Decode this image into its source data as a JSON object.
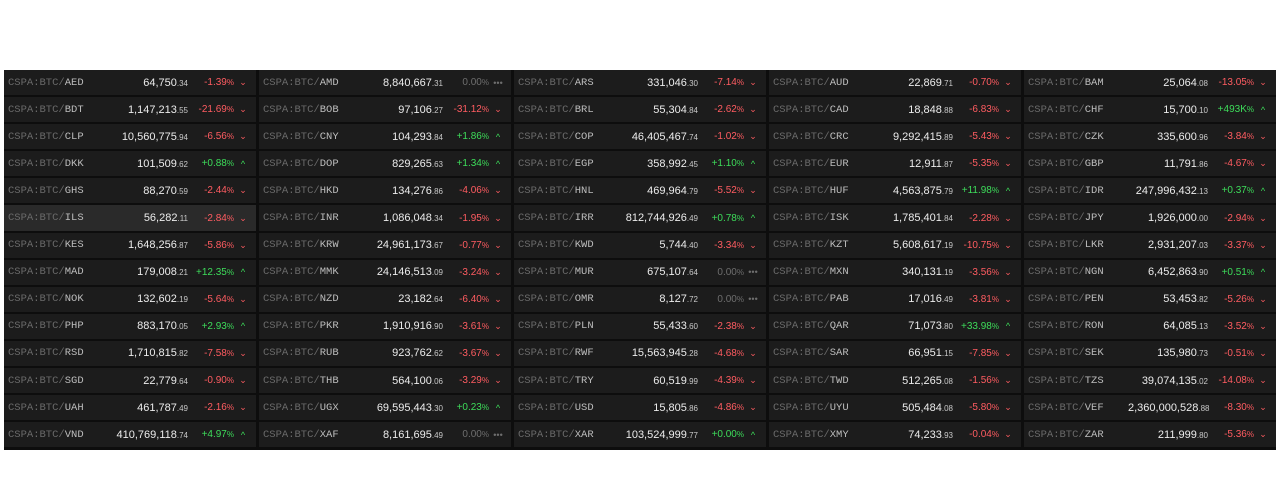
{
  "board": {
    "prefix": "CSPA:BTC/",
    "columns": [
      [
        {
          "ccy": "AED",
          "int": "64,750",
          "dec": ".34",
          "chg_int": "-1.39",
          "chg_tail": "%",
          "dir": "down",
          "arrow": "⌄"
        },
        {
          "ccy": "BDT",
          "int": "1,147,213",
          "dec": ".55",
          "chg_int": "-21.69",
          "chg_tail": "%",
          "dir": "down",
          "arrow": "⌄"
        },
        {
          "ccy": "CLP",
          "int": "10,560,775",
          "dec": ".94",
          "chg_int": "-6.56",
          "chg_tail": "%",
          "dir": "down",
          "arrow": "⌄"
        },
        {
          "ccy": "DKK",
          "int": "101,509",
          "dec": ".62",
          "chg_int": "+0.88",
          "chg_tail": "%",
          "dir": "up",
          "arrow": "^"
        },
        {
          "ccy": "GHS",
          "int": "88,270",
          "dec": ".59",
          "chg_int": "-2.44",
          "chg_tail": "%",
          "dir": "down",
          "arrow": "⌄"
        },
        {
          "ccy": "ILS",
          "int": "56,282",
          "dec": ".11",
          "chg_int": "-2.84",
          "chg_tail": "%",
          "dir": "down",
          "arrow": "⌄",
          "hl": true
        },
        {
          "ccy": "KES",
          "int": "1,648,256",
          "dec": ".87",
          "chg_int": "-5.86",
          "chg_tail": "%",
          "dir": "down",
          "arrow": "⌄"
        },
        {
          "ccy": "MAD",
          "int": "179,008",
          "dec": ".21",
          "chg_int": "+12.35",
          "chg_tail": "%",
          "dir": "up",
          "arrow": "^"
        },
        {
          "ccy": "NOK",
          "int": "132,602",
          "dec": ".19",
          "chg_int": "-5.64",
          "chg_tail": "%",
          "dir": "down",
          "arrow": "⌄"
        },
        {
          "ccy": "PHP",
          "int": "883,170",
          "dec": ".05",
          "chg_int": "+2.93",
          "chg_tail": "%",
          "dir": "up",
          "arrow": "^"
        },
        {
          "ccy": "RSD",
          "int": "1,710,815",
          "dec": ".82",
          "chg_int": "-7.58",
          "chg_tail": "%",
          "dir": "down",
          "arrow": "⌄"
        },
        {
          "ccy": "SGD",
          "int": "22,779",
          "dec": ".64",
          "chg_int": "-0.90",
          "chg_tail": "%",
          "dir": "down",
          "arrow": "⌄"
        },
        {
          "ccy": "UAH",
          "int": "461,787",
          "dec": ".49",
          "chg_int": "-2.16",
          "chg_tail": "%",
          "dir": "down",
          "arrow": "⌄"
        },
        {
          "ccy": "VND",
          "int": "410,769,118",
          "dec": ".74",
          "chg_int": "+4.97",
          "chg_tail": "%",
          "dir": "up",
          "arrow": "^"
        }
      ],
      [
        {
          "ccy": "AMD",
          "int": "8,840,667",
          "dec": ".31",
          "chg_int": "0.00",
          "chg_tail": "%",
          "dir": "flat",
          "arrow": "•••"
        },
        {
          "ccy": "BOB",
          "int": "97,106",
          "dec": ".27",
          "chg_int": "-31.12",
          "chg_tail": "%",
          "dir": "down",
          "arrow": "⌄"
        },
        {
          "ccy": "CNY",
          "int": "104,293",
          "dec": ".84",
          "chg_int": "+1.86",
          "chg_tail": "%",
          "dir": "up",
          "arrow": "^"
        },
        {
          "ccy": "DOP",
          "int": "829,265",
          "dec": ".63",
          "chg_int": "+1.34",
          "chg_tail": "%",
          "dir": "up",
          "arrow": "^"
        },
        {
          "ccy": "HKD",
          "int": "134,276",
          "dec": ".86",
          "chg_int": "-4.06",
          "chg_tail": "%",
          "dir": "down",
          "arrow": "⌄"
        },
        {
          "ccy": "INR",
          "int": "1,086,048",
          "dec": ".34",
          "chg_int": "-1.95",
          "chg_tail": "%",
          "dir": "down",
          "arrow": "⌄"
        },
        {
          "ccy": "KRW",
          "int": "24,961,173",
          "dec": ".67",
          "chg_int": "-0.77",
          "chg_tail": "%",
          "dir": "down",
          "arrow": "⌄"
        },
        {
          "ccy": "MMK",
          "int": "24,146,513",
          "dec": ".09",
          "chg_int": "-3.24",
          "chg_tail": "%",
          "dir": "down",
          "arrow": "⌄"
        },
        {
          "ccy": "NZD",
          "int": "23,182",
          "dec": ".64",
          "chg_int": "-6.40",
          "chg_tail": "%",
          "dir": "down",
          "arrow": "⌄"
        },
        {
          "ccy": "PKR",
          "int": "1,910,916",
          "dec": ".90",
          "chg_int": "-3.61",
          "chg_tail": "%",
          "dir": "down",
          "arrow": "⌄"
        },
        {
          "ccy": "RUB",
          "int": "923,762",
          "dec": ".62",
          "chg_int": "-3.67",
          "chg_tail": "%",
          "dir": "down",
          "arrow": "⌄"
        },
        {
          "ccy": "THB",
          "int": "564,100",
          "dec": ".06",
          "chg_int": "-3.29",
          "chg_tail": "%",
          "dir": "down",
          "arrow": "⌄"
        },
        {
          "ccy": "UGX",
          "int": "69,595,443",
          "dec": ".30",
          "chg_int": "+0.23",
          "chg_tail": "%",
          "dir": "up",
          "arrow": "^"
        },
        {
          "ccy": "XAF",
          "int": "8,161,695",
          "dec": ".49",
          "chg_int": "0.00",
          "chg_tail": "%",
          "dir": "flat",
          "arrow": "•••"
        }
      ],
      [
        {
          "ccy": "ARS",
          "int": "331,046",
          "dec": ".30",
          "chg_int": "-7.14",
          "chg_tail": "%",
          "dir": "down",
          "arrow": "⌄"
        },
        {
          "ccy": "BRL",
          "int": "55,304",
          "dec": ".84",
          "chg_int": "-2.62",
          "chg_tail": "%",
          "dir": "down",
          "arrow": "⌄"
        },
        {
          "ccy": "COP",
          "int": "46,405,467",
          "dec": ".74",
          "chg_int": "-1.02",
          "chg_tail": "%",
          "dir": "down",
          "arrow": "⌄"
        },
        {
          "ccy": "EGP",
          "int": "358,992",
          "dec": ".45",
          "chg_int": "+1.10",
          "chg_tail": "%",
          "dir": "up",
          "arrow": "^"
        },
        {
          "ccy": "HNL",
          "int": "469,964",
          "dec": ".79",
          "chg_int": "-5.52",
          "chg_tail": "%",
          "dir": "down",
          "arrow": "⌄"
        },
        {
          "ccy": "IRR",
          "int": "812,744,926",
          "dec": ".49",
          "chg_int": "+0.78",
          "chg_tail": "%",
          "dir": "up",
          "arrow": "^"
        },
        {
          "ccy": "KWD",
          "int": "5,744",
          "dec": ".40",
          "chg_int": "-3.34",
          "chg_tail": "%",
          "dir": "down",
          "arrow": "⌄"
        },
        {
          "ccy": "MUR",
          "int": "675,107",
          "dec": ".64",
          "chg_int": "0.00",
          "chg_tail": "%",
          "dir": "flat",
          "arrow": "•••"
        },
        {
          "ccy": "OMR",
          "int": "8,127",
          "dec": ".72",
          "chg_int": "0.00",
          "chg_tail": "%",
          "dir": "flat",
          "arrow": "•••"
        },
        {
          "ccy": "PLN",
          "int": "55,433",
          "dec": ".60",
          "chg_int": "-2.38",
          "chg_tail": "%",
          "dir": "down",
          "arrow": "⌄"
        },
        {
          "ccy": "RWF",
          "int": "15,563,945",
          "dec": ".28",
          "chg_int": "-4.68",
          "chg_tail": "%",
          "dir": "down",
          "arrow": "⌄"
        },
        {
          "ccy": "TRY",
          "int": "60,519",
          "dec": ".99",
          "chg_int": "-4.39",
          "chg_tail": "%",
          "dir": "down",
          "arrow": "⌄"
        },
        {
          "ccy": "USD",
          "int": "15,805",
          "dec": ".86",
          "chg_int": "-4.86",
          "chg_tail": "%",
          "dir": "down",
          "arrow": "⌄"
        },
        {
          "ccy": "XAR",
          "int": "103,524,999",
          "dec": ".77",
          "chg_int": "+0.00",
          "chg_tail": "%",
          "dir": "up",
          "arrow": "^"
        }
      ],
      [
        {
          "ccy": "AUD",
          "int": "22,869",
          "dec": ".71",
          "chg_int": "-0.70",
          "chg_tail": "%",
          "dir": "down",
          "arrow": "⌄"
        },
        {
          "ccy": "CAD",
          "int": "18,848",
          "dec": ".88",
          "chg_int": "-6.83",
          "chg_tail": "%",
          "dir": "down",
          "arrow": "⌄"
        },
        {
          "ccy": "CRC",
          "int": "9,292,415",
          "dec": ".89",
          "chg_int": "-5.43",
          "chg_tail": "%",
          "dir": "down",
          "arrow": "⌄"
        },
        {
          "ccy": "EUR",
          "int": "12,911",
          "dec": ".87",
          "chg_int": "-5.35",
          "chg_tail": "%",
          "dir": "down",
          "arrow": "⌄"
        },
        {
          "ccy": "HUF",
          "int": "4,563,875",
          "dec": ".79",
          "chg_int": "+11.98",
          "chg_tail": "%",
          "dir": "up",
          "arrow": "^"
        },
        {
          "ccy": "ISK",
          "int": "1,785,401",
          "dec": ".84",
          "chg_int": "-2.28",
          "chg_tail": "%",
          "dir": "down",
          "arrow": "⌄"
        },
        {
          "ccy": "KZT",
          "int": "5,608,617",
          "dec": ".19",
          "chg_int": "-10.75",
          "chg_tail": "%",
          "dir": "down",
          "arrow": "⌄"
        },
        {
          "ccy": "MXN",
          "int": "340,131",
          "dec": ".19",
          "chg_int": "-3.56",
          "chg_tail": "%",
          "dir": "down",
          "arrow": "⌄"
        },
        {
          "ccy": "PAB",
          "int": "17,016",
          "dec": ".49",
          "chg_int": "-3.81",
          "chg_tail": "%",
          "dir": "down",
          "arrow": "⌄"
        },
        {
          "ccy": "QAR",
          "int": "71,073",
          "dec": ".80",
          "chg_int": "+33.98",
          "chg_tail": "%",
          "dir": "up",
          "arrow": "^"
        },
        {
          "ccy": "SAR",
          "int": "66,951",
          "dec": ".15",
          "chg_int": "-7.85",
          "chg_tail": "%",
          "dir": "down",
          "arrow": "⌄"
        },
        {
          "ccy": "TWD",
          "int": "512,265",
          "dec": ".08",
          "chg_int": "-1.56",
          "chg_tail": "%",
          "dir": "down",
          "arrow": "⌄"
        },
        {
          "ccy": "UYU",
          "int": "505,484",
          "dec": ".08",
          "chg_int": "-5.80",
          "chg_tail": "%",
          "dir": "down",
          "arrow": "⌄"
        },
        {
          "ccy": "XMY",
          "int": "74,233",
          "dec": ".93",
          "chg_int": "-0.04",
          "chg_tail": "%",
          "dir": "down",
          "arrow": "⌄"
        }
      ],
      [
        {
          "ccy": "BAM",
          "int": "25,064",
          "dec": ".08",
          "chg_int": "-13.05",
          "chg_tail": "%",
          "dir": "down",
          "arrow": "⌄"
        },
        {
          "ccy": "CHF",
          "int": "15,700",
          "dec": ".10",
          "chg_int": "+493K",
          "chg_tail": "%",
          "dir": "up",
          "arrow": "^"
        },
        {
          "ccy": "CZK",
          "int": "335,600",
          "dec": ".96",
          "chg_int": "-3.84",
          "chg_tail": "%",
          "dir": "down",
          "arrow": "⌄"
        },
        {
          "ccy": "GBP",
          "int": "11,791",
          "dec": ".86",
          "chg_int": "-4.67",
          "chg_tail": "%",
          "dir": "down",
          "arrow": "⌄"
        },
        {
          "ccy": "IDR",
          "int": "247,996,432",
          "dec": ".13",
          "chg_int": "+0.37",
          "chg_tail": "%",
          "dir": "up",
          "arrow": "^"
        },
        {
          "ccy": "JPY",
          "int": "1,926,000",
          "dec": ".00",
          "chg_int": "-2.94",
          "chg_tail": "%",
          "dir": "down",
          "arrow": "⌄"
        },
        {
          "ccy": "LKR",
          "int": "2,931,207",
          "dec": ".03",
          "chg_int": "-3.37",
          "chg_tail": "%",
          "dir": "down",
          "arrow": "⌄"
        },
        {
          "ccy": "NGN",
          "int": "6,452,863",
          "dec": ".90",
          "chg_int": "+0.51",
          "chg_tail": "%",
          "dir": "up",
          "arrow": "^"
        },
        {
          "ccy": "PEN",
          "int": "53,453",
          "dec": ".82",
          "chg_int": "-5.26",
          "chg_tail": "%",
          "dir": "down",
          "arrow": "⌄"
        },
        {
          "ccy": "RON",
          "int": "64,085",
          "dec": ".13",
          "chg_int": "-3.52",
          "chg_tail": "%",
          "dir": "down",
          "arrow": "⌄"
        },
        {
          "ccy": "SEK",
          "int": "135,980",
          "dec": ".73",
          "chg_int": "-0.51",
          "chg_tail": "%",
          "dir": "down",
          "arrow": "⌄"
        },
        {
          "ccy": "TZS",
          "int": "39,074,135",
          "dec": ".02",
          "chg_int": "-14.08",
          "chg_tail": "%",
          "dir": "down",
          "arrow": "⌄"
        },
        {
          "ccy": "VEF",
          "int": "2,360,000,528",
          "dec": ".88",
          "chg_int": "-8.30",
          "chg_tail": "%",
          "dir": "down",
          "arrow": "⌄"
        },
        {
          "ccy": "ZAR",
          "int": "211,999",
          "dec": ".80",
          "chg_int": "-5.36",
          "chg_tail": "%",
          "dir": "down",
          "arrow": "⌄"
        }
      ]
    ]
  },
  "colors": {
    "up": "#3ddc5a",
    "down": "#ff5c61",
    "flat": "#6e6e6e",
    "row_bg": "#1c1c1c",
    "board_bg": "#0d0d0d"
  }
}
